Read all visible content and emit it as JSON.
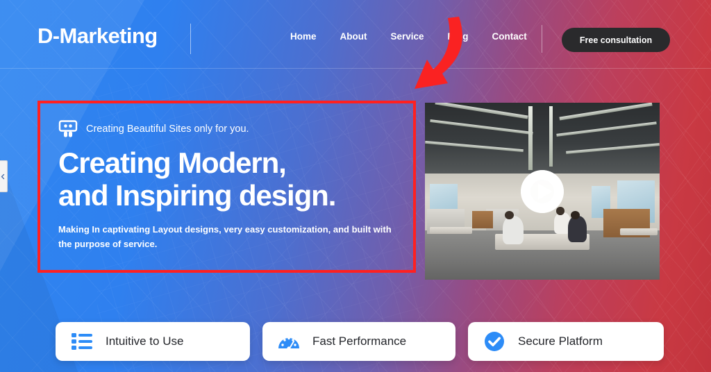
{
  "page": {
    "background_blue": "#2f86f0",
    "background_red": "#c2343d",
    "accent_blue": "#2d8cf7",
    "annotation_red": "#ff2020"
  },
  "header": {
    "logo": "D-Marketing",
    "nav_items": [
      {
        "label": "Home"
      },
      {
        "label": "About"
      },
      {
        "label": "Service"
      },
      {
        "label": "Blog"
      },
      {
        "label": "Contact"
      }
    ],
    "cta_label": "Free consultation"
  },
  "hero": {
    "tagline_icon": "presentation-board-icon",
    "tagline": "Creating Beautiful Sites only for you.",
    "title_line_1": "Creating Modern,",
    "title_line_2": "and Inspiring design.",
    "subtitle": "Making In captivating Layout designs, very easy customization, and built with the purpose of service."
  },
  "media": {
    "play_icon": "play-icon",
    "caption": ""
  },
  "cards": [
    {
      "icon": "list-icon",
      "label": "Intuitive to Use"
    },
    {
      "icon": "speedometer-icon",
      "label": "Fast Performance"
    },
    {
      "icon": "check-circle-icon",
      "label": "Secure Platform"
    }
  ],
  "slider": {
    "prev_icon": "chevron-left-icon"
  },
  "annotation": {
    "arrow_icon": "curved-arrow-icon",
    "highlight_box": "hero-text-highlight"
  }
}
